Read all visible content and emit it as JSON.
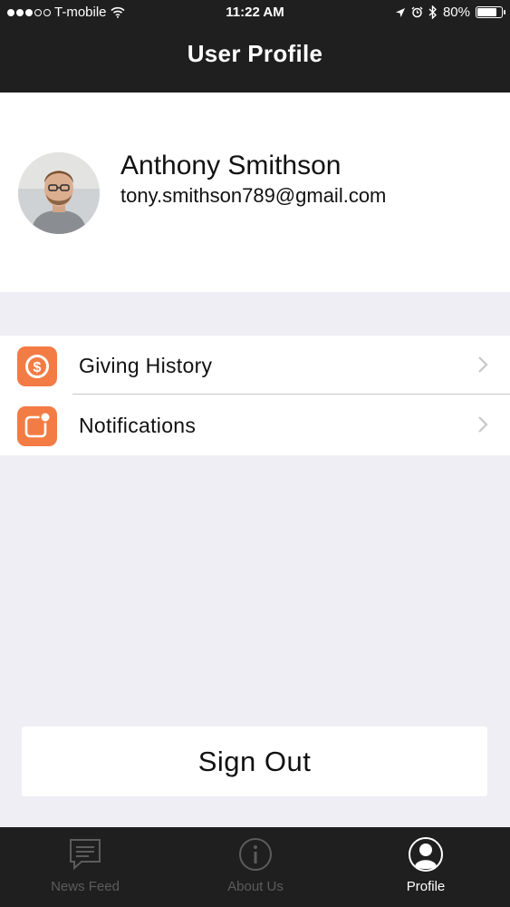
{
  "status_bar": {
    "carrier": "T-mobile",
    "time": "11:22 AM",
    "battery_percent": "80%",
    "battery_level": 0.8,
    "signal_bars_filled": 3,
    "signal_bars_total": 5,
    "icons": [
      "wifi-icon",
      "location-arrow-icon",
      "alarm-icon",
      "bluetooth-icon",
      "battery-icon"
    ]
  },
  "nav": {
    "title": "User Profile"
  },
  "profile": {
    "name": "Anthony Smithson",
    "email": "tony.smithson789@gmail.com",
    "avatar_icon": "user-photo"
  },
  "menu": {
    "items": [
      {
        "label": "Giving History",
        "icon": "dollar-coin-icon",
        "accent": "#f37c45"
      },
      {
        "label": "Notifications",
        "icon": "notification-badge-icon",
        "accent": "#f37c45"
      }
    ]
  },
  "sign_out": {
    "label": "Sign Out"
  },
  "tabbar": {
    "tabs": [
      {
        "label": "News Feed",
        "icon": "chat-bubble-icon",
        "active": false
      },
      {
        "label": "About Us",
        "icon": "info-icon",
        "active": false
      },
      {
        "label": "Profile",
        "icon": "person-icon",
        "active": true
      }
    ]
  },
  "colors": {
    "bar_background": "#1f1f1f",
    "page_background": "#efeef4",
    "accent": "#f37c45",
    "tab_inactive": "#5c5c5c",
    "tab_active": "#ffffff"
  }
}
